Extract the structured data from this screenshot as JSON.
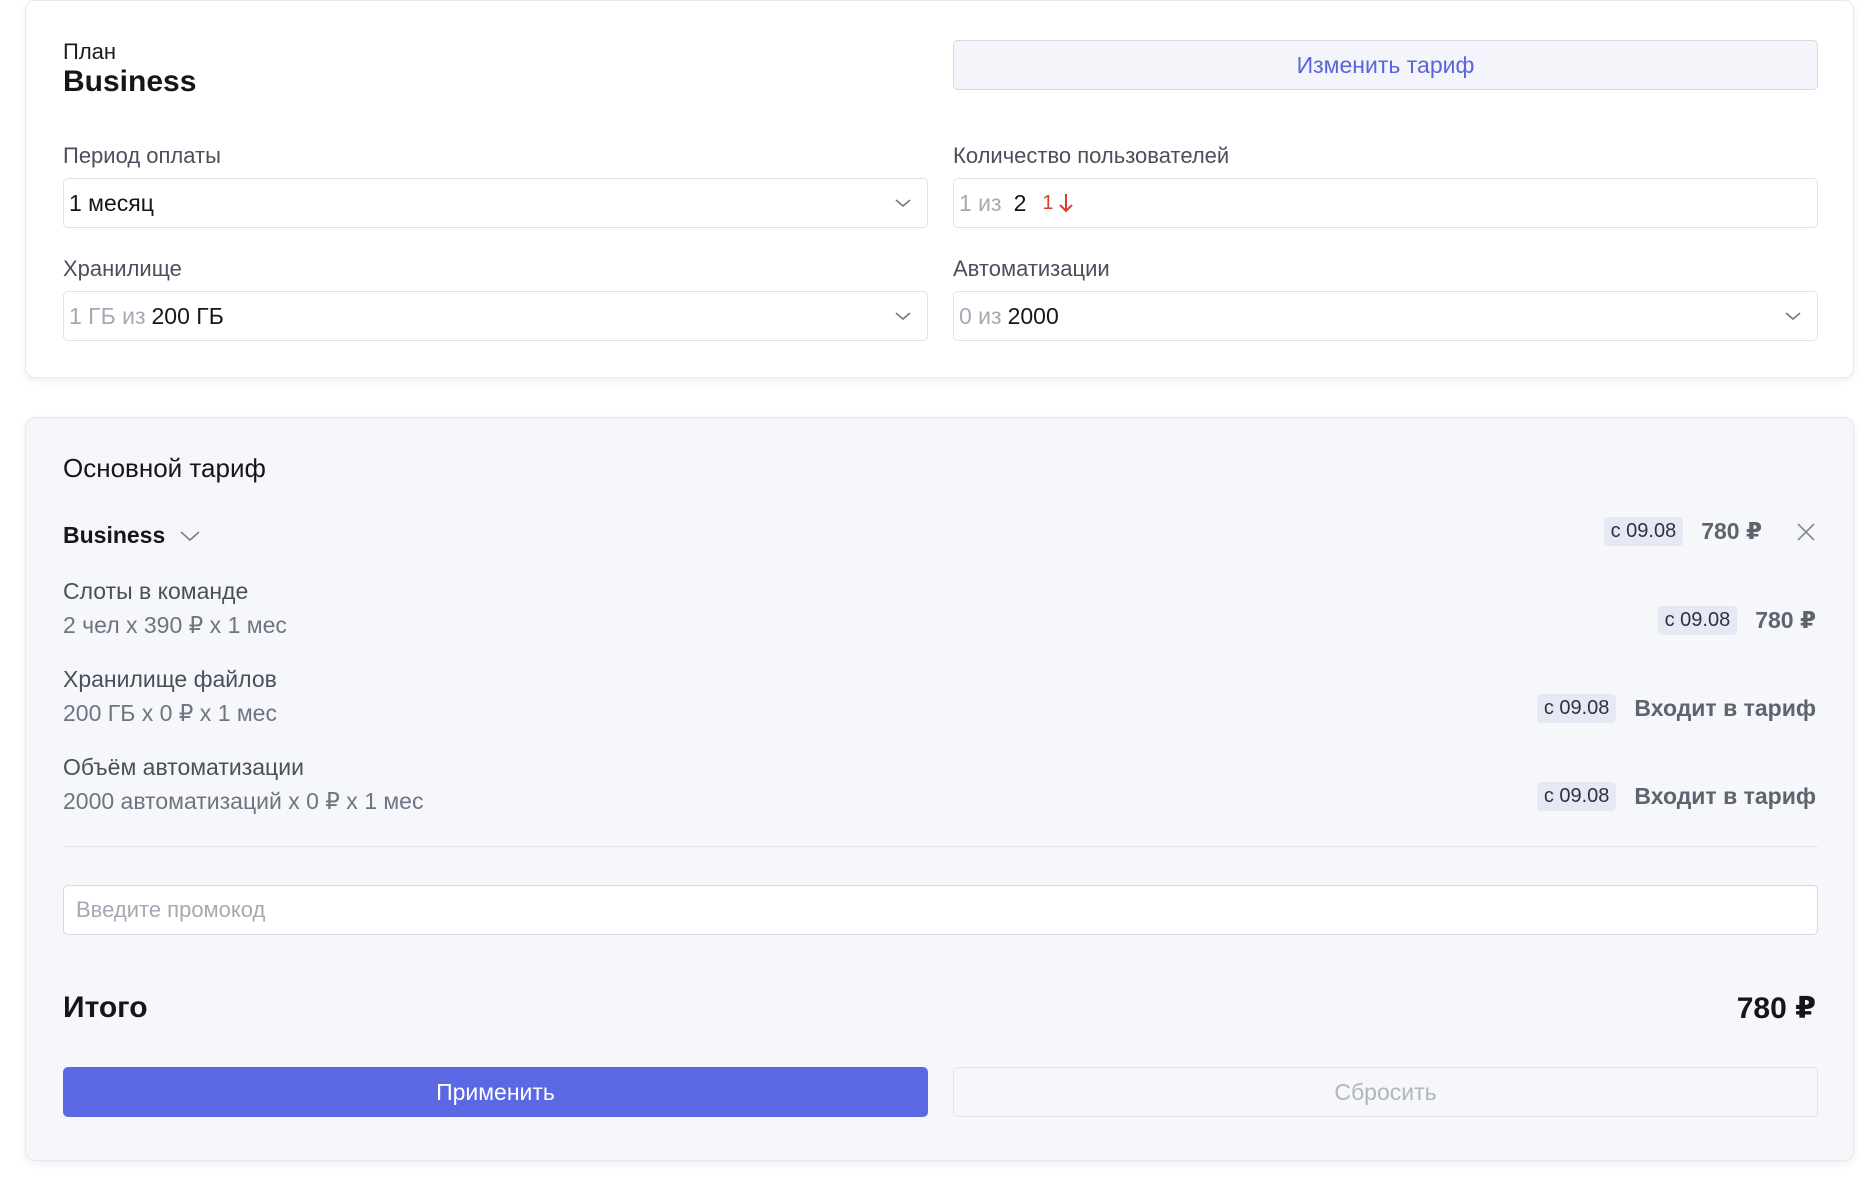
{
  "plan": {
    "label": "План",
    "name": "Business",
    "change_button": "Изменить тариф"
  },
  "fields": {
    "period": {
      "label": "Период оплаты",
      "value": "1 месяц"
    },
    "users": {
      "label": "Количество пользователей",
      "used": "1 из",
      "value": "2",
      "delta": "1"
    },
    "storage": {
      "label": "Хранилище",
      "used": "1 ГБ из",
      "value": "200 ГБ"
    },
    "automations": {
      "label": "Автоматизации",
      "used": "0 из",
      "value": "2000"
    }
  },
  "tariff": {
    "section_title": "Основной тариф",
    "main": {
      "name": "Business",
      "date": "с 09.08",
      "price": "780 ₽"
    },
    "rows": [
      {
        "title": "Слоты в команде",
        "sub": "2 чел х 390 ₽ х 1 мес",
        "date": "с 09.08",
        "price": "780 ₽"
      },
      {
        "title": "Хранилище файлов",
        "sub": "200 ГБ х 0 ₽ х 1 мес",
        "date": "с 09.08",
        "price": "Входит в тариф"
      },
      {
        "title": "Объём автоматизации",
        "sub": "2000 автоматизаций х 0 ₽ х 1 мес",
        "date": "с 09.08",
        "price": "Входит в тариф"
      }
    ],
    "promo_placeholder": "Введите промокод",
    "total_label": "Итого",
    "total_value": "780 ₽",
    "apply_button": "Применить",
    "reset_button": "Сбросить"
  },
  "colors": {
    "accent": "#5b68e3",
    "link": "#5a64dd",
    "decrease": "#d2432a"
  }
}
